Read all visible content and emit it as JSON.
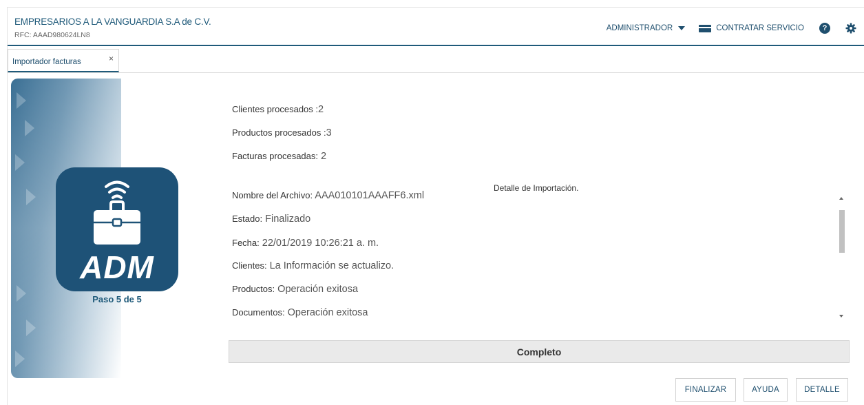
{
  "header": {
    "company": "EMPRESARIOS A LA VANGUARDIA S.A de C.V.",
    "rfc": "RFC: AAAD980624LN8",
    "user": "ADMINISTRADOR",
    "contract": "CONTRATAR SERVICIO",
    "help_symbol": "?"
  },
  "tabs": [
    {
      "label": "Importador facturas",
      "close": "×"
    }
  ],
  "banner": {
    "logo_text": "ADM",
    "step": "Paso 5 de 5"
  },
  "summary": [
    {
      "label": "Clientes procesados :",
      "value": "2"
    },
    {
      "label": "Productos procesados :",
      "value": "3"
    },
    {
      "label": "Facturas procesadas:",
      "value": " 2"
    }
  ],
  "detail": {
    "title": "Detalle de Importación.",
    "rows": [
      {
        "label": "Nombre del Archivo:",
        "value": " AAA010101AAAFF6.xml"
      },
      {
        "label": "Estado:",
        "value": " Finalizado"
      },
      {
        "label": "Fecha:",
        "value": " 22/01/2019 10:26:21 a. m."
      },
      {
        "label": "Clientes:",
        "value": " La Información se actualizo."
      },
      {
        "label": "Productos:",
        "value": " Operación exitosa"
      },
      {
        "label": "Documentos:",
        "value": " Operación exitosa"
      }
    ]
  },
  "progress": {
    "label": "Completo",
    "fraction": 1.0
  },
  "buttons": {
    "finish": "FINALIZAR",
    "help": "AYUDA",
    "detail": "DETALLE"
  },
  "colors": {
    "primary": "#1f5a7a",
    "logo_bg": "#1e5277"
  },
  "icons": {
    "user_caret": "caret-down-icon",
    "contract": "credit-card-icon",
    "help": "help-circle-icon",
    "settings": "gear-icon"
  }
}
